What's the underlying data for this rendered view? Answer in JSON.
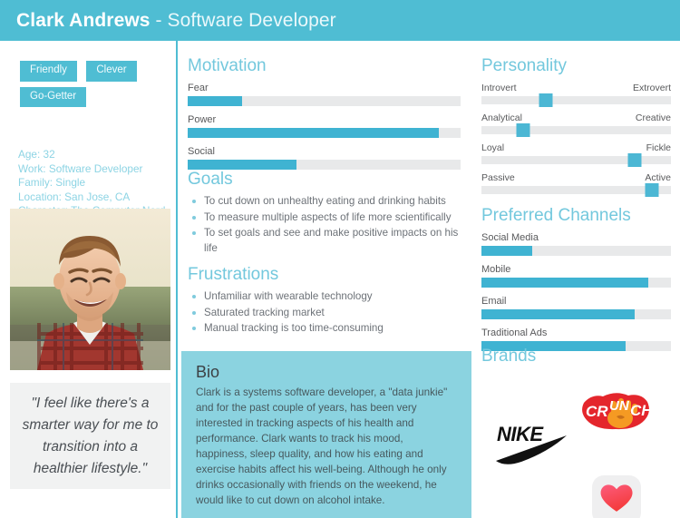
{
  "header": {
    "name": "Clark Andrews",
    "separator": " - ",
    "role": "Software Developer"
  },
  "sidebar": {
    "tags": [
      "Friendly",
      "Clever",
      "Go-Getter"
    ],
    "facts": [
      "Age: 32",
      "Work: Software Developer",
      "Family: Single",
      "Location: San Jose, CA",
      "Character: The Computer Nerd"
    ],
    "photo_alt": "portrait-photo-smiling-man-plaid-shirt",
    "quote": "\"I feel like there's a smarter way for me to transition into a healthier lifestyle.\""
  },
  "motivation": {
    "title": "Motivation",
    "bars": [
      {
        "label": "Fear",
        "value": 20
      },
      {
        "label": "Power",
        "value": 92
      },
      {
        "label": "Social",
        "value": 40
      }
    ]
  },
  "goals": {
    "title": "Goals",
    "items": [
      "To cut down on unhealthy eating and drinking habits",
      "To measure multiple aspects of life more scientifically",
      "To set goals and see and make positive impacts on his life"
    ]
  },
  "frustrations": {
    "title": "Frustrations",
    "items": [
      "Unfamiliar with wearable technology",
      "Saturated tracking market",
      "Manual tracking is too time-consuming"
    ]
  },
  "bio": {
    "title": "Bio",
    "text": "Clark is a systems software developer, a \"data junkie\" and for the past couple of years, has been very interested in tracking aspects of his health and performance. Clark wants to track his mood, happiness, sleep quality, and how his eating and exercise habits affect his well-being. Although he only drinks occasionally with friends on the weekend, he would like to cut down on alcohol intake."
  },
  "personality": {
    "title": "Personality",
    "sliders": [
      {
        "left": "Introvert",
        "right": "Extrovert",
        "value": 34
      },
      {
        "left": "Analytical",
        "right": "Creative",
        "value": 22
      },
      {
        "left": "Loyal",
        "right": "Fickle",
        "value": 81
      },
      {
        "left": "Passive",
        "right": "Active",
        "value": 90
      }
    ]
  },
  "channels": {
    "title": "Preferred Channels",
    "bars": [
      {
        "label": "Social Media",
        "value": 27
      },
      {
        "label": "Mobile",
        "value": 88
      },
      {
        "label": "Email",
        "value": 81
      },
      {
        "label": "Traditional Ads",
        "value": 76
      }
    ]
  },
  "brands": {
    "title": "Brands",
    "items": [
      {
        "name": "nike-logo",
        "label": "NIKE"
      },
      {
        "name": "crunch-fitness-logo",
        "label": "CRUNCH"
      },
      {
        "name": "apple-health-logo",
        "label": "Health"
      }
    ]
  },
  "colors": {
    "brand_teal": "#4fbdd3",
    "heading_teal": "#73c8dd",
    "bio_panel": "#8bd3e0",
    "bar_fill": "#3fb3d2",
    "bar_track": "#e8e9ea",
    "quote_panel": "#f1f2f2"
  }
}
